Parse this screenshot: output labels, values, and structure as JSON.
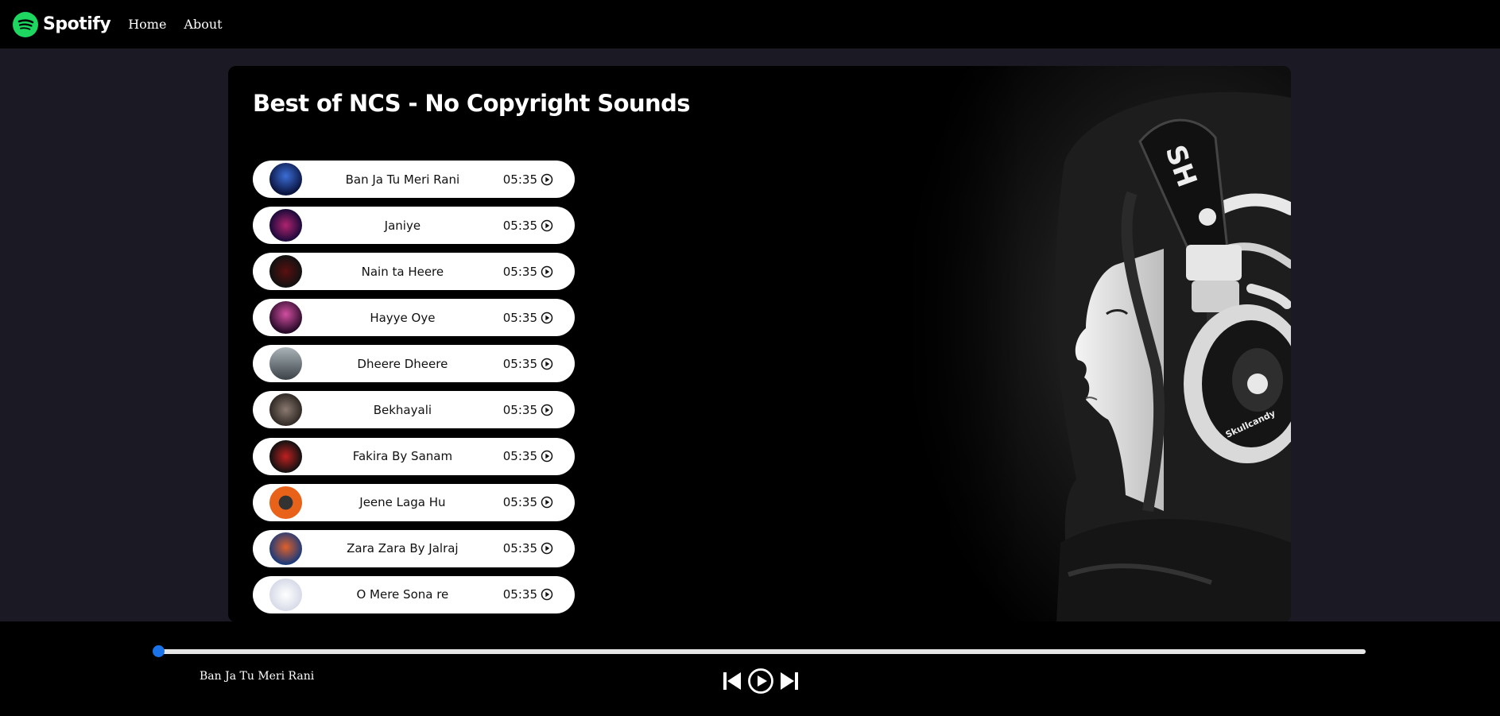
{
  "nav": {
    "brand": "Spotify",
    "links": [
      "Home",
      "About"
    ]
  },
  "main": {
    "title": "Best of NCS - No Copyright Sounds"
  },
  "songs": [
    {
      "name": "Ban Ja Tu Meri Rani",
      "duration": "05:35"
    },
    {
      "name": "Janiye",
      "duration": "05:35"
    },
    {
      "name": "Nain ta Heere",
      "duration": "05:35"
    },
    {
      "name": "Hayye Oye",
      "duration": "05:35"
    },
    {
      "name": "Dheere Dheere",
      "duration": "05:35"
    },
    {
      "name": "Bekhayali",
      "duration": "05:35"
    },
    {
      "name": "Fakira By Sanam",
      "duration": "05:35"
    },
    {
      "name": "Jeene Laga Hu",
      "duration": "05:35"
    },
    {
      "name": "Zara Zara By Jalraj",
      "duration": "05:35"
    },
    {
      "name": "O Mere Sona re",
      "duration": "05:35"
    }
  ],
  "player": {
    "current_song": "Ban Ja Tu Meri Rani",
    "progress": 0
  },
  "colors": {
    "brand_green": "#1ed760",
    "accent_blue": "#1a73e8",
    "page_bg": "#1b1a24"
  }
}
